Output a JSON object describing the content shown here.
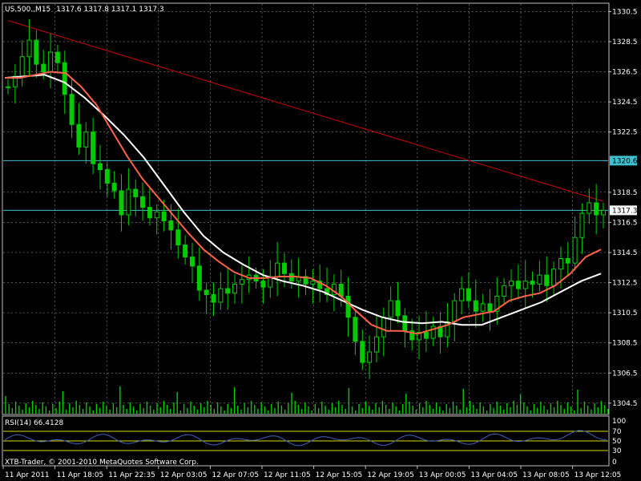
{
  "header": {
    "symbol": "US.500.,M15",
    "ohlc": "1317.6 1317.8 1317.1 1317.3"
  },
  "rsi": {
    "label": "RSI(14) 66.4128",
    "levels": [
      70,
      50,
      30
    ],
    "axis_ticks": [
      "100",
      "70",
      "50",
      "30",
      "0"
    ]
  },
  "footer": {
    "copyright": "XTB-Trader, © 2001-2010 MetaQuotes Software Corp."
  },
  "price_labels": {
    "resistance": "1320.6",
    "current": "1317.3"
  },
  "colors": {
    "background": "#000000",
    "grid": "#8a8a8a",
    "candles": "#00cc00",
    "ma_fast": "#ff6347",
    "ma_slow": "#ffffff",
    "trendline": "#cc0000",
    "hline": "#40c0d0",
    "rsi_line": "#4060c0",
    "rsi_levels": "#d8d800",
    "text": "#ffffff"
  },
  "chart_data": {
    "type": "line",
    "y_ticks": [
      "1330.5",
      "1328.5",
      "1326.5",
      "1324.5",
      "1322.5",
      "1318.5",
      "1316.5",
      "1314.5",
      "1312.5",
      "1310.5",
      "1308.5",
      "1306.5",
      "1304.5"
    ],
    "x_ticks": [
      "11 Apr 2011",
      "11 Apr 18:05",
      "11 Apr 22:35",
      "12 Apr 03:05",
      "12 Apr 07:05",
      "12 Apr 11:05",
      "12 Apr 15:05",
      "12 Apr 19:05",
      "13 Apr 00:05",
      "13 Apr 04:05",
      "13 Apr 08:05",
      "13 Apr 12:05"
    ],
    "ylim": [
      1303.8,
      1331
    ],
    "close": [
      1325.5,
      1326.2,
      1327.5,
      1328.6,
      1327.0,
      1326.5,
      1327.8,
      1327.1,
      1325.0,
      1323.0,
      1321.5,
      1322.5,
      1320.4,
      1320.0,
      1319.1,
      1318.6,
      1317.0,
      1318.7,
      1318.2,
      1317.5,
      1316.8,
      1317.2,
      1316.6,
      1316.0,
      1315.0,
      1314.2,
      1313.6,
      1312.0,
      1311.7,
      1311.2,
      1312.1,
      1311.8,
      1312.4,
      1312.7,
      1313.0,
      1312.6,
      1312.2,
      1312.9,
      1313.8,
      1313.1,
      1312.6,
      1312.9,
      1312.4,
      1312.6,
      1312.1,
      1311.7,
      1312.4,
      1311.6,
      1310.2,
      1308.6,
      1307.2,
      1307.9,
      1308.9,
      1310.2,
      1311.3,
      1310.3,
      1309.3,
      1308.7,
      1309.2,
      1308.8,
      1309.6,
      1308.9,
      1309.9,
      1311.3,
      1312.1,
      1311.3,
      1310.6,
      1311.1,
      1310.6,
      1311.6,
      1312.3,
      1312.6,
      1312.1,
      1312.6,
      1312.4,
      1313.0,
      1312.3,
      1313.4,
      1314.1,
      1313.8,
      1315.5,
      1317.1,
      1317.8,
      1317.0,
      1317.3
    ],
    "ma_fast": [
      1326.1,
      1326.1,
      1326.3,
      1326.5,
      1326.4,
      1325.5,
      1324.3,
      1322.6,
      1320.9,
      1319.4,
      1318.2,
      1317.0,
      1315.8,
      1314.7,
      1313.9,
      1313.2,
      1312.8,
      1312.8,
      1312.9,
      1312.9,
      1312.8,
      1312.3,
      1311.6,
      1310.6,
      1309.7,
      1309.3,
      1309.3,
      1309.1,
      1309.4,
      1309.7,
      1310.2,
      1310.4,
      1310.6,
      1311.3,
      1311.6,
      1311.8,
      1312.3,
      1313.1,
      1314.2,
      1314.7
    ],
    "ma_slow": [
      1326.1,
      1326.2,
      1326.3,
      1325.8,
      1324.8,
      1323.6,
      1322.3,
      1320.8,
      1319.0,
      1317.2,
      1315.6,
      1314.5,
      1313.7,
      1313.0,
      1312.6,
      1312.3,
      1311.9,
      1311.3,
      1310.7,
      1310.2,
      1309.9,
      1309.8,
      1309.9,
      1309.7,
      1309.7,
      1310.2,
      1310.7,
      1311.2,
      1311.9,
      1312.6,
      1313.1
    ],
    "trendline": [
      [
        0,
        1329.9
      ],
      [
        84,
        1317.9
      ]
    ],
    "hlines": [
      1320.6,
      1317.3
    ]
  }
}
